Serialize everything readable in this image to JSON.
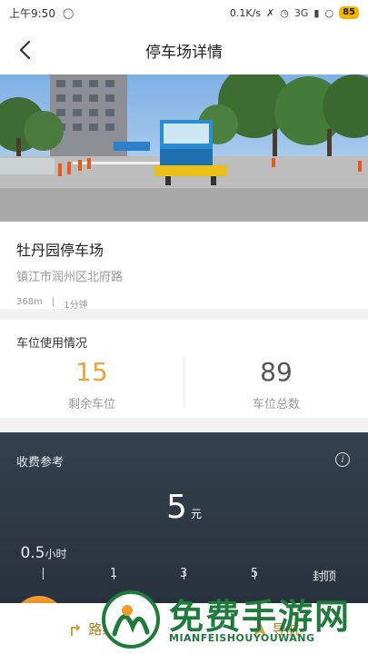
{
  "status_bar": {
    "time": "上午9:50",
    "speed": "0.1K/s",
    "network": "3G",
    "battery": "85"
  },
  "header": {
    "title": "停车场详情",
    "back_icon": "chevron-left-icon"
  },
  "lot": {
    "name": "牡丹园停车场",
    "address": "镇江市润州区北府路",
    "distance": "368m",
    "separator": "|",
    "time": "1分钟"
  },
  "spaces": {
    "title": "车位使用情况",
    "remaining_value": "15",
    "remaining_label": "剩余车位",
    "total_value": "89",
    "total_label": "车位总数"
  },
  "fee": {
    "title": "收费参考",
    "amount": "5",
    "unit": "元",
    "ticks": [
      {
        "value": "0.5",
        "unit": "小时"
      },
      {
        "value": "1"
      },
      {
        "value": "3"
      },
      {
        "value": "5"
      },
      {
        "value": "封顶"
      }
    ]
  },
  "bottom": {
    "route_label": "路线",
    "navigate_label": "导航"
  },
  "watermark": {
    "title": "免费手游网",
    "subtitle": "MIANFEISHOUYOUWANG"
  },
  "colors": {
    "accent_orange": "#f29a2e",
    "remaining_color": "#f0a23a",
    "fee_bg": "#2b3540",
    "watermark_green": "#1f7a3c"
  }
}
